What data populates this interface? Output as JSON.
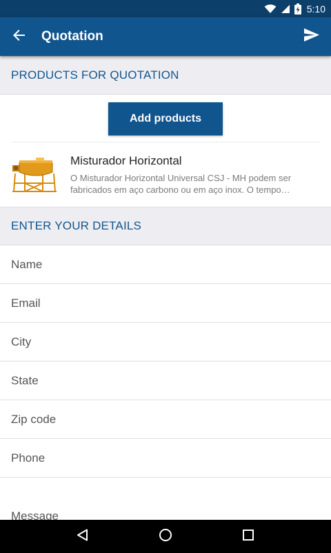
{
  "status_bar": {
    "time": "5:10"
  },
  "app_bar": {
    "title": "Quotation"
  },
  "products_section": {
    "header": "PRODUCTS FOR QUOTATION",
    "add_button": "Add products",
    "items": [
      {
        "name": "Misturador Horizontal",
        "description": "O Misturador Horizontal Universal CSJ - MH podem ser fabricados em aço carbono ou em aço inox. O tempo…"
      }
    ]
  },
  "details_section": {
    "header": "ENTER YOUR DETAILS",
    "fields": {
      "name": {
        "placeholder": "Name",
        "value": ""
      },
      "email": {
        "placeholder": "Email",
        "value": ""
      },
      "city": {
        "placeholder": "City",
        "value": ""
      },
      "state": {
        "placeholder": "State",
        "value": ""
      },
      "zip": {
        "placeholder": "Zip code",
        "value": ""
      },
      "phone": {
        "placeholder": "Phone",
        "value": ""
      },
      "message": {
        "placeholder": "Message",
        "value": ""
      }
    }
  },
  "icons": {
    "back": "arrow-left-icon",
    "send": "send-icon",
    "wifi": "wifi-icon",
    "signal": "cell-signal-icon",
    "battery": "battery-charging-icon",
    "nav_back": "nav-back-icon",
    "nav_home": "nav-home-icon",
    "nav_recents": "nav-recents-icon"
  },
  "colors": {
    "status_bar": "#0c3f6a",
    "primary": "#11558e",
    "section_bg": "#eeeef2",
    "nav_bar": "#000000"
  }
}
